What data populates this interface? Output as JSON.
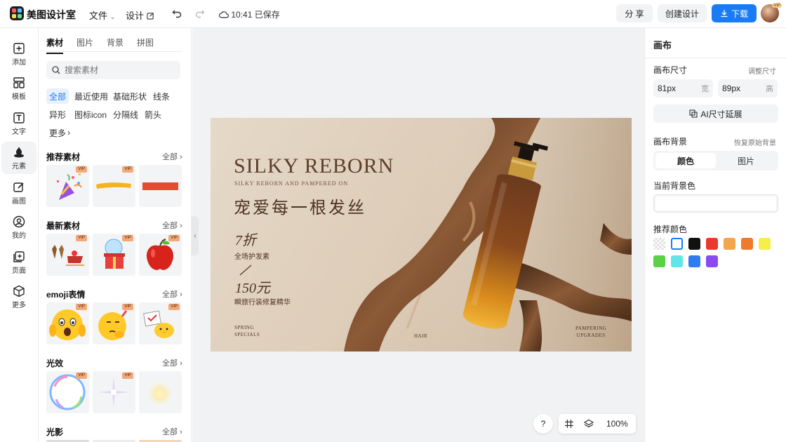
{
  "header": {
    "brand": "美图设计室",
    "file_menu": "文件",
    "design_menu": "设计",
    "save_status": "10:41 已保存",
    "share": "分 享",
    "create": "创建设计",
    "download": "下载",
    "vip_badge": "VIP",
    "colors": {
      "accent": "#1a7cf5"
    }
  },
  "nav": [
    {
      "label": "添加",
      "icon": "plus-square-icon"
    },
    {
      "label": "模板",
      "icon": "template-icon"
    },
    {
      "label": "文字",
      "icon": "text-icon"
    },
    {
      "label": "元素",
      "icon": "shapes-icon"
    },
    {
      "label": "画图",
      "icon": "pencil-icon"
    },
    {
      "label": "我的",
      "icon": "user-icon"
    },
    {
      "label": "页面",
      "icon": "page-add-icon"
    },
    {
      "label": "更多",
      "icon": "cube-icon"
    }
  ],
  "panel": {
    "tabs": [
      "素材",
      "图片",
      "背景",
      "拼图"
    ],
    "search_placeholder": "搜索素材",
    "chips": [
      "全部",
      "最近使用",
      "基础形状",
      "线条",
      "异形",
      "图标icon",
      "分隔线",
      "箭头",
      "更多"
    ],
    "sections": [
      {
        "title": "推荐素材",
        "all": "全部"
      },
      {
        "title": "最新素材",
        "all": "全部"
      },
      {
        "title": "emoji表情",
        "all": "全部"
      },
      {
        "title": "光效",
        "all": "全部"
      },
      {
        "title": "光影",
        "all": "全部"
      }
    ],
    "vip": "VIP"
  },
  "canvas": {
    "title": "SILKY REBORN",
    "subtitle": "SILKY REBORN AND PAMPERED ON",
    "headline_cn": "宠爱每一根发丝",
    "discount": "7折",
    "discount_note": "全场护发素",
    "price": "150元",
    "price_note": "瞬旅行装修复精华",
    "foot_left": "SPRING\nSPECIALS",
    "foot_mid": "HAIR",
    "foot_right": "PAMPERING\nUPGRADES"
  },
  "bottom": {
    "help": "?",
    "zoom": "100%"
  },
  "right": {
    "title": "画布",
    "size_label": "画布尺寸",
    "adjust": "调整尺寸",
    "width_value": "81px",
    "width_unit": "宽",
    "height_value": "89px",
    "height_unit": "高",
    "ai_extend": "AI尺寸延展",
    "bg_label": "画布背景",
    "restore": "恢复原始背景",
    "seg_color": "颜色",
    "seg_image": "图片",
    "current_bg": "当前背景色",
    "recommend": "推荐颜色",
    "swatches": [
      "transparent",
      "#ffffff",
      "#111111",
      "#e63b2e",
      "#f2a64d",
      "#ee7a2c",
      "#f6ef4a",
      "#5bd14a",
      "#5fe7e8",
      "#2f7cf1",
      "#8a4cf2"
    ]
  }
}
